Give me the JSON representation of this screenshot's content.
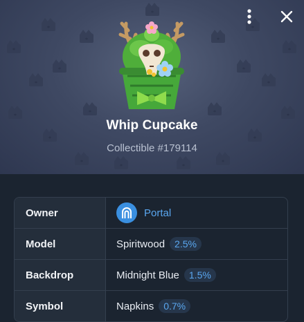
{
  "header": {
    "more_icon": "more-vertical-icon",
    "close_icon": "close-icon"
  },
  "gift": {
    "title": "Whip Cupcake",
    "subtitle": "Collectible #179114"
  },
  "attributes": [
    {
      "label": "Owner",
      "value": "Portal",
      "avatar_icon": "portal-arch-icon"
    },
    {
      "label": "Model",
      "value": "Spiritwood",
      "rarity": "2.5%"
    },
    {
      "label": "Backdrop",
      "value": "Midnight Blue",
      "rarity": "1.5%"
    },
    {
      "label": "Symbol",
      "value": "Napkins",
      "rarity": "0.7%"
    }
  ],
  "colors": {
    "accent": "#5aa7f0",
    "backdrop": "#3f4963",
    "page_background": "#1b2430"
  }
}
